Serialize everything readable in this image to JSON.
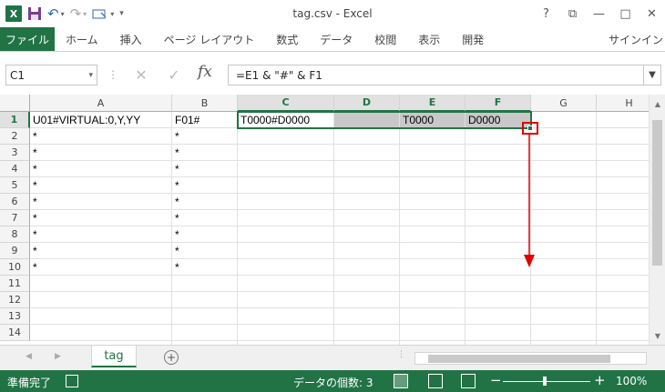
{
  "window": {
    "title": "tag.csv - Excel",
    "help": "?",
    "minimize": "—",
    "maximize": "□",
    "close": "✕",
    "restore": "⧉"
  },
  "qat": {
    "logo": "X",
    "undo_arrow": "↶",
    "redo_arrow": "↷",
    "more": "▾"
  },
  "ribbon": {
    "file": "ファイル",
    "tabs": [
      "ホーム",
      "挿入",
      "ページ レイアウト",
      "数式",
      "データ",
      "校閲",
      "表示",
      "開発"
    ],
    "signin": "サインイン"
  },
  "formula_bar": {
    "name_box": "C1",
    "formula": "=E1 & \"#\" & F1",
    "fx": "fx",
    "cancel": "✕",
    "enter": "✓"
  },
  "grid": {
    "columns": [
      "A",
      "B",
      "C",
      "D",
      "E",
      "F",
      "G",
      "H"
    ],
    "rows": [
      "1",
      "2",
      "3",
      "4",
      "5",
      "6",
      "7",
      "8",
      "9",
      "10",
      "11",
      "12",
      "13",
      "14"
    ],
    "cells": {
      "A1": "U01#VIRTUAL:0,Y,YY",
      "B1": "F01#",
      "C1": "T0000#D0000",
      "E1": "T0000",
      "F1": "D0000",
      "A2": "*",
      "B2": "*",
      "A3": "*",
      "B3": "*",
      "A4": "*",
      "B4": "*",
      "A5": "*",
      "B5": "*",
      "A6": "*",
      "B6": "*",
      "A7": "*",
      "B7": "*",
      "A8": "*",
      "B8": "*",
      "A9": "*",
      "B9": "*",
      "A10": "*",
      "B10": "*"
    }
  },
  "sheets": {
    "tabs": [
      "tag"
    ],
    "active": "tag",
    "add": "+"
  },
  "status": {
    "ready": "準備完了",
    "count": "データの個数: 3",
    "zoom_minus": "−",
    "zoom_plus": "+",
    "zoom": "100%"
  },
  "colors": {
    "accent": "#217346",
    "highlight": "#c8c8c8",
    "annotation": "#e00000"
  }
}
